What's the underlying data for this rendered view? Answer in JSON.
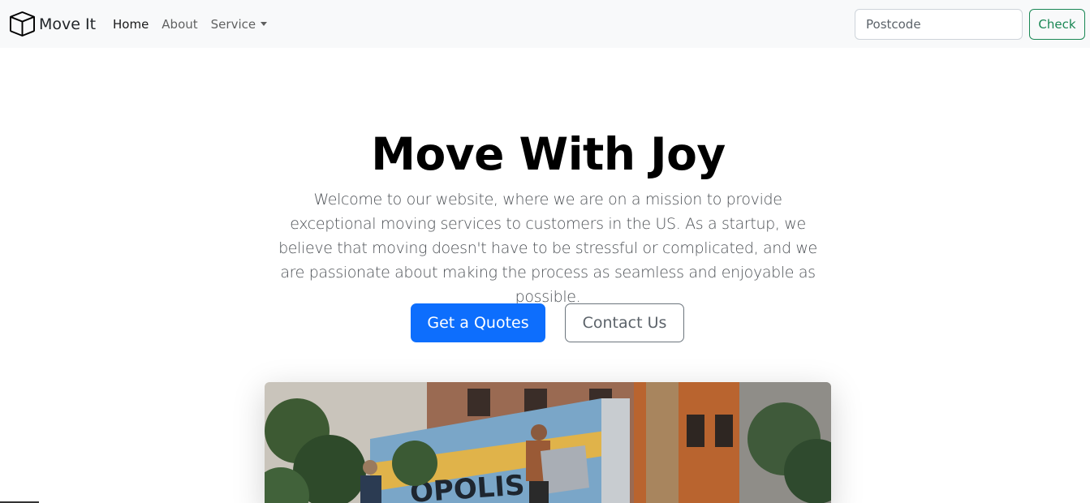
{
  "navbar": {
    "brand_name": "Move It",
    "brand_icon": "box-icon",
    "links": [
      {
        "label": "Home",
        "active": true
      },
      {
        "label": "About",
        "active": false
      },
      {
        "label": "Service",
        "active": false,
        "dropdown": true
      }
    ],
    "search": {
      "placeholder": "Postcode",
      "value": ""
    },
    "check_label": "Check"
  },
  "hero": {
    "title": "Move With Joy",
    "lead": "Welcome to our website, where we are on a mission to provide exceptional moving services to customers in the US. As a startup, we believe that moving doesn't have to be stressful or complicated, and we are passionate about making the process as seamless and enjoyable as possible.",
    "primary_button": "Get a Quotes",
    "secondary_button": "Contact Us",
    "truck_text": "OPOLIS"
  },
  "colors": {
    "primary": "#0d6efd",
    "success": "#198754",
    "navbar_bg": "#f8f9fa"
  }
}
